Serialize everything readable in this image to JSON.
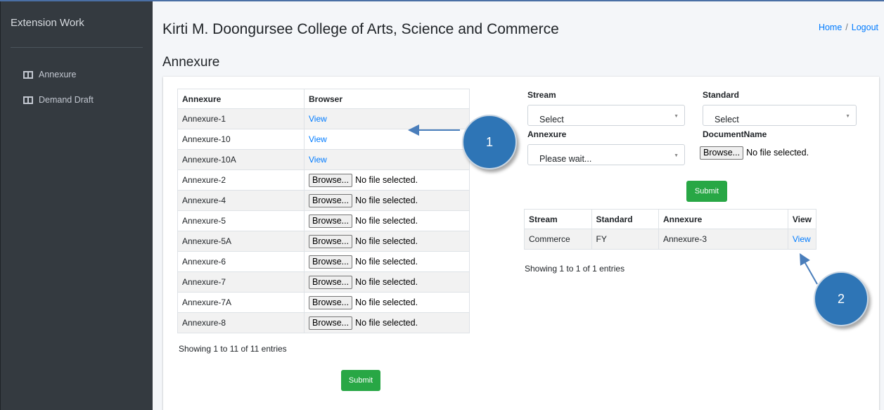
{
  "sidebar": {
    "brand": "Extension Work",
    "items": [
      {
        "label": "Annexure",
        "icon": "columns-icon"
      },
      {
        "label": "Demand Draft",
        "icon": "columns-icon"
      }
    ]
  },
  "header": {
    "college": "Kirti M. Doongursee College of Arts, Science and Commerce",
    "home": "Home",
    "separator": "/",
    "logout": "Logout"
  },
  "page_title": "Annexure",
  "left_table": {
    "columns": [
      "Annexure",
      "Browser"
    ],
    "rows": [
      {
        "name": "Annexure-1",
        "type": "view",
        "value": "View"
      },
      {
        "name": "Annexure-10",
        "type": "view",
        "value": "View"
      },
      {
        "name": "Annexure-10A",
        "type": "view",
        "value": "View"
      },
      {
        "name": "Annexure-2",
        "type": "file",
        "button": "Browse...",
        "status": "No file selected."
      },
      {
        "name": "Annexure-4",
        "type": "file",
        "button": "Browse...",
        "status": "No file selected."
      },
      {
        "name": "Annexure-5",
        "type": "file",
        "button": "Browse...",
        "status": "No file selected."
      },
      {
        "name": "Annexure-5A",
        "type": "file",
        "button": "Browse...",
        "status": "No file selected."
      },
      {
        "name": "Annexure-6",
        "type": "file",
        "button": "Browse...",
        "status": "No file selected."
      },
      {
        "name": "Annexure-7",
        "type": "file",
        "button": "Browse...",
        "status": "No file selected."
      },
      {
        "name": "Annexure-7A",
        "type": "file",
        "button": "Browse...",
        "status": "No file selected."
      },
      {
        "name": "Annexure-8",
        "type": "file",
        "button": "Browse...",
        "status": "No file selected."
      }
    ],
    "showing": "Showing 1 to 11 of 11 entries",
    "submit": "Submit"
  },
  "form": {
    "stream_label": "Stream",
    "stream_value": "Select",
    "standard_label": "Standard",
    "standard_value": "Select",
    "annexure_label": "Annexure",
    "annexure_value": "Please wait...",
    "document_label": "DocumentName",
    "document_button": "Browse...",
    "document_status": "No file selected.",
    "submit": "Submit"
  },
  "right_table": {
    "columns": [
      "Stream",
      "Standard",
      "Annexure",
      "View"
    ],
    "rows": [
      {
        "stream": "Commerce",
        "standard": "FY",
        "annexure": "Annexure-3",
        "view": "View"
      }
    ],
    "showing": "Showing 1 to 1 of 1 entries"
  },
  "callouts": [
    "1",
    "2"
  ],
  "colors": {
    "sidebar_bg": "#343a40",
    "link": "#007bff",
    "submit": "#28a745",
    "callout": "#2e75b6"
  }
}
